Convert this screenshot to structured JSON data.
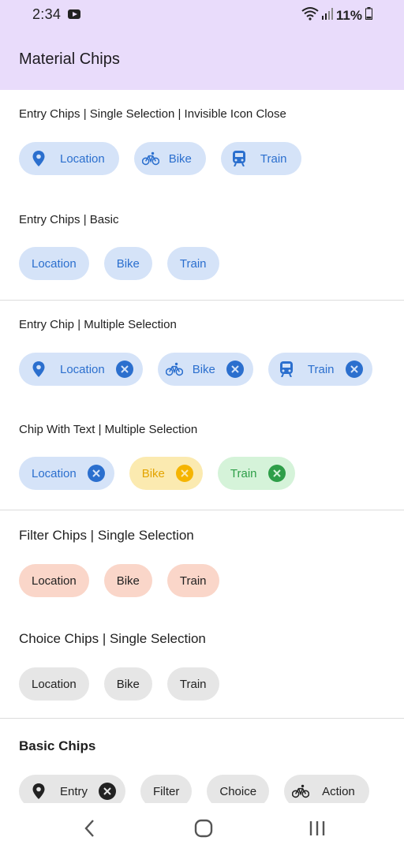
{
  "status_bar": {
    "time": "2:34",
    "battery": "11%"
  },
  "app_bar": {
    "title": "Material Chips"
  },
  "sections": [
    {
      "title": "Entry Chips | Single Selection | Invisible Icon Close",
      "chips": [
        {
          "label": "Location",
          "icon": "location-pin-icon"
        },
        {
          "label": "Bike",
          "icon": "bike-icon"
        },
        {
          "label": "Train",
          "icon": "train-icon"
        }
      ]
    },
    {
      "title": "Entry Chips | Basic",
      "chips": [
        {
          "label": "Location"
        },
        {
          "label": "Bike"
        },
        {
          "label": "Train"
        }
      ]
    },
    {
      "title": "Entry Chip  | Multiple Selection",
      "chips": [
        {
          "label": "Location",
          "icon": "location-pin-icon",
          "close": true
        },
        {
          "label": "Bike",
          "icon": "bike-icon",
          "close": true
        },
        {
          "label": "Train",
          "icon": "train-icon",
          "close": true
        }
      ]
    },
    {
      "title": "Chip With Text | Multiple Selection",
      "chips": [
        {
          "label": "Location",
          "close": true,
          "color": "#2b6fce"
        },
        {
          "label": "Bike",
          "close": true,
          "color": "#e3a400"
        },
        {
          "label": "Train",
          "close": true,
          "color": "#2e9e48"
        }
      ]
    },
    {
      "title": "Filter Chips | Single Selection",
      "chips": [
        {
          "label": "Location"
        },
        {
          "label": "Bike"
        },
        {
          "label": "Train"
        }
      ]
    },
    {
      "title": "Choice Chips | Single Selection",
      "chips": [
        {
          "label": "Location"
        },
        {
          "label": "Bike"
        },
        {
          "label": "Train"
        }
      ]
    },
    {
      "title": "Basic Chips",
      "chips": [
        {
          "label": "Entry",
          "icon": "location-pin-icon",
          "close": true
        },
        {
          "label": "Filter"
        },
        {
          "label": "Choice"
        },
        {
          "label": "Action",
          "icon": "bike-icon"
        }
      ]
    }
  ],
  "colors": {
    "app_bar": "#e9dcfb",
    "blue": "#2b6fce",
    "yellow": "#e3a400",
    "green": "#2e9e48"
  }
}
